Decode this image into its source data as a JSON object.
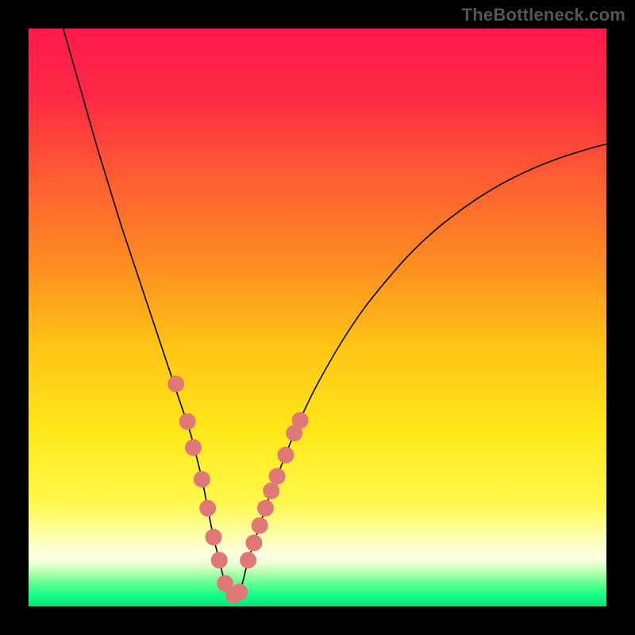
{
  "watermark": "TheBottleneck.com",
  "colors": {
    "background": "#000000",
    "gradient_stops": [
      {
        "offset": 0.0,
        "color": "#ff1a4d"
      },
      {
        "offset": 0.12,
        "color": "#ff2a44"
      },
      {
        "offset": 0.25,
        "color": "#ff5a33"
      },
      {
        "offset": 0.4,
        "color": "#ff8a22"
      },
      {
        "offset": 0.55,
        "color": "#ffc414"
      },
      {
        "offset": 0.7,
        "color": "#ffe81a"
      },
      {
        "offset": 0.82,
        "color": "#fff84a"
      },
      {
        "offset": 0.88,
        "color": "#fdffb0"
      },
      {
        "offset": 0.913,
        "color": "#ffffe6"
      },
      {
        "offset": 0.927,
        "color": "#e8ffd0"
      },
      {
        "offset": 0.94,
        "color": "#b8ffb0"
      },
      {
        "offset": 0.96,
        "color": "#5fff90"
      },
      {
        "offset": 0.98,
        "color": "#18ff88"
      },
      {
        "offset": 1.0,
        "color": "#00e676"
      }
    ],
    "curve_stroke": "#000000",
    "point_fill": "#e07878",
    "point_stroke": "#c86060"
  },
  "chart_data": {
    "type": "line",
    "title": "",
    "xlabel": "",
    "ylabel": "",
    "xlim": [
      0,
      100
    ],
    "ylim": [
      0,
      100
    ],
    "grid": false,
    "legend": false,
    "annotations": [],
    "series": [
      {
        "name": "bottleneck-curve",
        "x": [
          6,
          8,
          10,
          12,
          14,
          16,
          18,
          20,
          22,
          24,
          26,
          28,
          30,
          31,
          32,
          33,
          34,
          35,
          36,
          37,
          38,
          40,
          42,
          44,
          46,
          48,
          50,
          54,
          58,
          62,
          66,
          70,
          74,
          78,
          82,
          86,
          90,
          94,
          98,
          100
        ],
        "y": [
          100,
          93,
          86,
          79,
          72.5,
          66,
          60,
          54,
          48,
          42,
          36,
          30,
          22,
          17,
          12,
          8,
          4,
          2,
          2,
          4,
          8,
          14,
          20,
          25,
          30,
          34.5,
          38.5,
          45.5,
          51.5,
          56.5,
          61,
          64.8,
          68,
          70.8,
          73.2,
          75.2,
          76.9,
          78.3,
          79.5,
          80
        ]
      }
    ],
    "scatter": [
      {
        "name": "highlighted-points",
        "x": [
          25.5,
          27.5,
          28.5,
          30.0,
          31.0,
          32.0,
          33.0,
          34.0,
          35.5,
          36.5,
          38.0,
          39.0,
          40.0,
          41.0,
          42.0,
          43.0,
          44.5,
          46.0,
          47.0
        ],
        "y": [
          38.5,
          32.0,
          27.5,
          22.0,
          17.0,
          12.0,
          8.0,
          4.0,
          2.0,
          2.5,
          8.0,
          11.0,
          14.0,
          17.0,
          20.0,
          22.5,
          26.2,
          30.0,
          32.2
        ]
      }
    ]
  }
}
